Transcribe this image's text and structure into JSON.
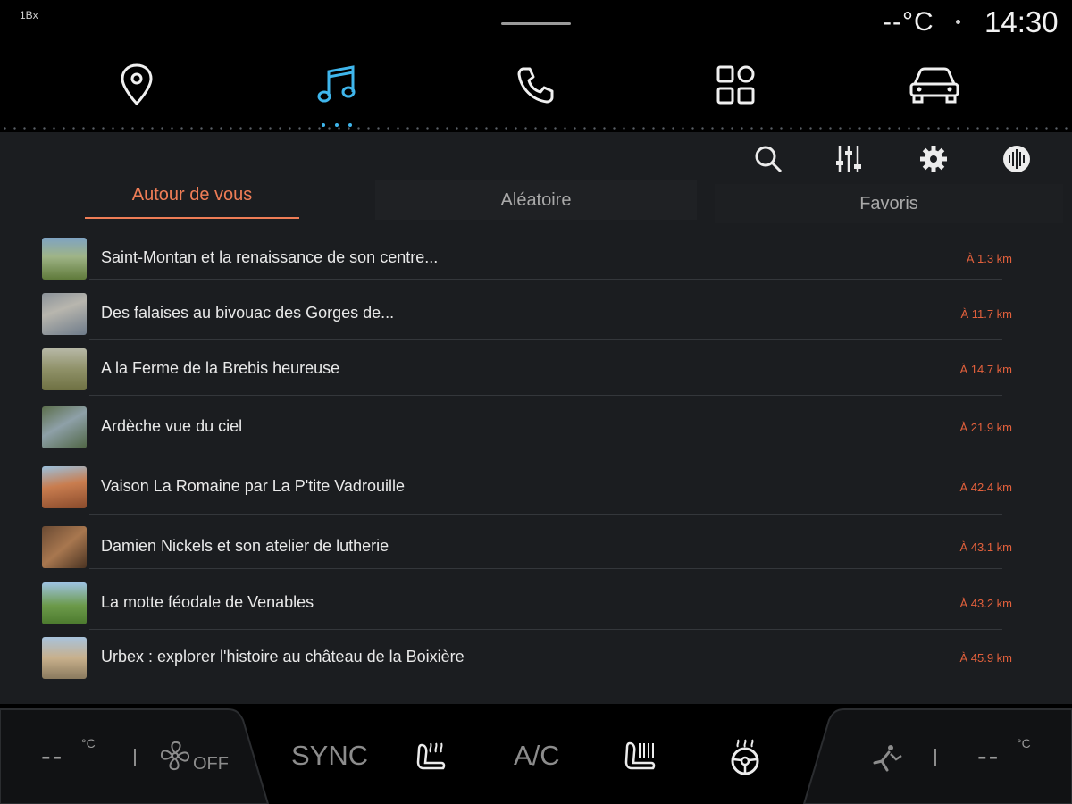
{
  "status": {
    "temperature": "--°C",
    "time": "14:30",
    "corner_label": "1Bx"
  },
  "nav": {
    "items": [
      "location-pin-icon",
      "music-note-icon",
      "phone-icon",
      "apps-grid-icon",
      "car-icon"
    ],
    "active": "music-note-icon",
    "accent_color": "#3fb6ec"
  },
  "toolbar": {
    "icons": [
      "search-icon",
      "equalizer-icon",
      "gear-icon",
      "source-icon"
    ]
  },
  "tabs": {
    "around": "Autour de vous",
    "random": "Aléatoire",
    "favorites": "Favoris",
    "active": "around",
    "accent_color": "#ef7d56"
  },
  "list": {
    "items": [
      {
        "title": "Saint-Montan et la renaissance de son centre...",
        "distance": "À 1.3 km"
      },
      {
        "title": "Des falaises au bivouac des Gorges de...",
        "distance": "À 11.7 km"
      },
      {
        "title": "A la Ferme de la Brebis heureuse",
        "distance": "À 14.7 km"
      },
      {
        "title": "Ardèche vue du ciel",
        "distance": "À 21.9 km"
      },
      {
        "title": "Vaison La Romaine par La P'tite Vadrouille",
        "distance": "À 42.4 km"
      },
      {
        "title": "Damien Nickels et son atelier de lutherie",
        "distance": "À 43.1 km"
      },
      {
        "title": "La motte féodale de Venables",
        "distance": "À 43.2 km"
      },
      {
        "title": "Urbex : explorer l'histoire au château de la Boixière",
        "distance": "À 45.9 km"
      }
    ],
    "distance_color": "#e2603c"
  },
  "climate": {
    "left_temp": "--",
    "left_unit": "°C",
    "fan_label": "OFF",
    "sync_label": "SYNC",
    "ac_label": "A/C",
    "right_temp": "--",
    "right_unit": "°C"
  }
}
